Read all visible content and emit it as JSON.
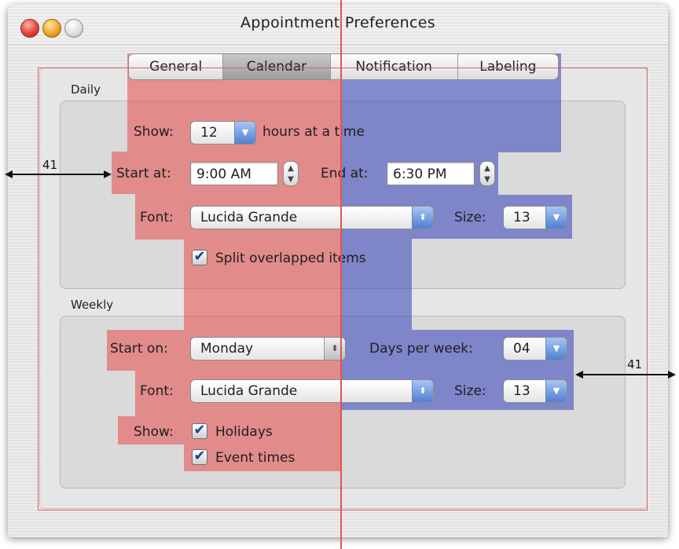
{
  "window": {
    "title": "Appointment Preferences"
  },
  "tabs": [
    {
      "label": "General",
      "selected": false
    },
    {
      "label": "Calendar",
      "selected": true
    },
    {
      "label": "Notification",
      "selected": false
    },
    {
      "label": "Labeling",
      "selected": false
    }
  ],
  "daily": {
    "section_label": "Daily",
    "show_label": "Show:",
    "show_value": "12",
    "show_suffix": "hours at a time",
    "start_label": "Start at:",
    "start_value": "9:00 AM",
    "end_label": "End at:",
    "end_value": "6:30 PM",
    "font_label": "Font:",
    "font_value": "Lucida Grande",
    "size_label": "Size:",
    "size_value": "13",
    "split_label": "Split overlapped items",
    "split_checked": true
  },
  "weekly": {
    "section_label": "Weekly",
    "start_on_label": "Start on:",
    "start_on_value": "Monday",
    "days_label": "Days per week:",
    "days_value": "04",
    "font_label": "Font:",
    "font_value": "Lucida Grande",
    "size_label": "Size:",
    "size_value": "13",
    "show_label": "Show:",
    "holidays_label": "Holidays",
    "holidays_checked": true,
    "event_times_label": "Event times",
    "event_times_checked": true
  },
  "annotations": {
    "left_margin": "41",
    "right_margin": "41"
  },
  "colors": {
    "overlay_left": "#e65a5a",
    "overlay_right": "#4650be",
    "guide_line": "#e05555",
    "popup_accent": "#4f7fd1"
  }
}
